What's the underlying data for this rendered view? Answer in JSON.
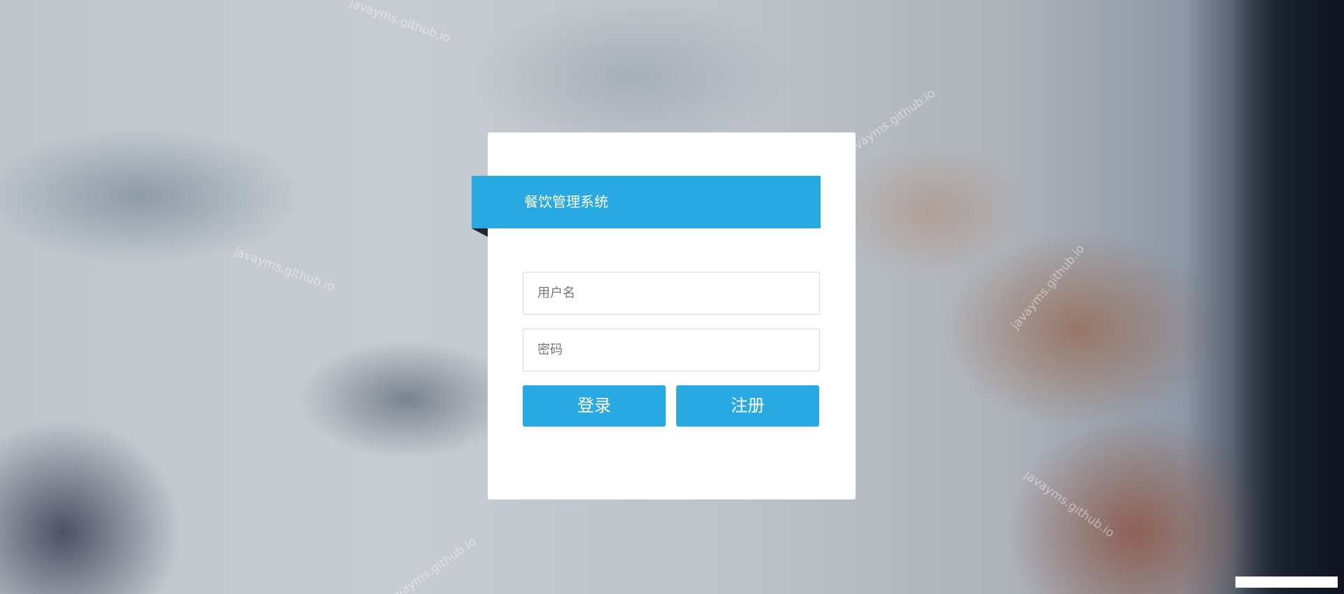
{
  "app": {
    "title": "餐饮管理系统"
  },
  "watermark": {
    "text": "javayms.github.io"
  },
  "login_form": {
    "username_placeholder": "用户名",
    "password_placeholder": "密码",
    "login_label": "登录",
    "register_label": "注册"
  },
  "colors": {
    "accent": "#29a9e1",
    "card": "#ffffff"
  }
}
